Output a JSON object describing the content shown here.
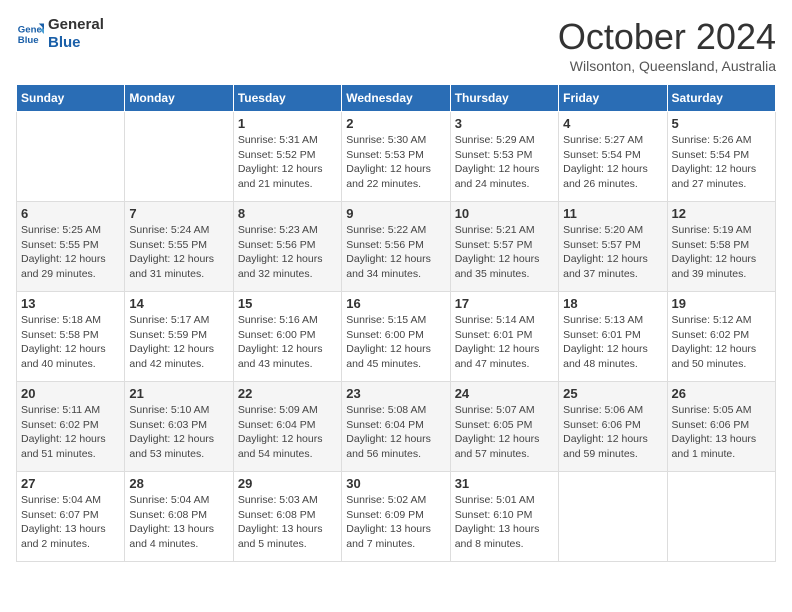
{
  "logo": {
    "line1": "General",
    "line2": "Blue"
  },
  "title": "October 2024",
  "subtitle": "Wilsonton, Queensland, Australia",
  "weekdays": [
    "Sunday",
    "Monday",
    "Tuesday",
    "Wednesday",
    "Thursday",
    "Friday",
    "Saturday"
  ],
  "weeks": [
    [
      {
        "day": "",
        "info": ""
      },
      {
        "day": "",
        "info": ""
      },
      {
        "day": "1",
        "info": "Sunrise: 5:31 AM\nSunset: 5:52 PM\nDaylight: 12 hours and 21 minutes."
      },
      {
        "day": "2",
        "info": "Sunrise: 5:30 AM\nSunset: 5:53 PM\nDaylight: 12 hours and 22 minutes."
      },
      {
        "day": "3",
        "info": "Sunrise: 5:29 AM\nSunset: 5:53 PM\nDaylight: 12 hours and 24 minutes."
      },
      {
        "day": "4",
        "info": "Sunrise: 5:27 AM\nSunset: 5:54 PM\nDaylight: 12 hours and 26 minutes."
      },
      {
        "day": "5",
        "info": "Sunrise: 5:26 AM\nSunset: 5:54 PM\nDaylight: 12 hours and 27 minutes."
      }
    ],
    [
      {
        "day": "6",
        "info": "Sunrise: 5:25 AM\nSunset: 5:55 PM\nDaylight: 12 hours and 29 minutes."
      },
      {
        "day": "7",
        "info": "Sunrise: 5:24 AM\nSunset: 5:55 PM\nDaylight: 12 hours and 31 minutes."
      },
      {
        "day": "8",
        "info": "Sunrise: 5:23 AM\nSunset: 5:56 PM\nDaylight: 12 hours and 32 minutes."
      },
      {
        "day": "9",
        "info": "Sunrise: 5:22 AM\nSunset: 5:56 PM\nDaylight: 12 hours and 34 minutes."
      },
      {
        "day": "10",
        "info": "Sunrise: 5:21 AM\nSunset: 5:57 PM\nDaylight: 12 hours and 35 minutes."
      },
      {
        "day": "11",
        "info": "Sunrise: 5:20 AM\nSunset: 5:57 PM\nDaylight: 12 hours and 37 minutes."
      },
      {
        "day": "12",
        "info": "Sunrise: 5:19 AM\nSunset: 5:58 PM\nDaylight: 12 hours and 39 minutes."
      }
    ],
    [
      {
        "day": "13",
        "info": "Sunrise: 5:18 AM\nSunset: 5:58 PM\nDaylight: 12 hours and 40 minutes."
      },
      {
        "day": "14",
        "info": "Sunrise: 5:17 AM\nSunset: 5:59 PM\nDaylight: 12 hours and 42 minutes."
      },
      {
        "day": "15",
        "info": "Sunrise: 5:16 AM\nSunset: 6:00 PM\nDaylight: 12 hours and 43 minutes."
      },
      {
        "day": "16",
        "info": "Sunrise: 5:15 AM\nSunset: 6:00 PM\nDaylight: 12 hours and 45 minutes."
      },
      {
        "day": "17",
        "info": "Sunrise: 5:14 AM\nSunset: 6:01 PM\nDaylight: 12 hours and 47 minutes."
      },
      {
        "day": "18",
        "info": "Sunrise: 5:13 AM\nSunset: 6:01 PM\nDaylight: 12 hours and 48 minutes."
      },
      {
        "day": "19",
        "info": "Sunrise: 5:12 AM\nSunset: 6:02 PM\nDaylight: 12 hours and 50 minutes."
      }
    ],
    [
      {
        "day": "20",
        "info": "Sunrise: 5:11 AM\nSunset: 6:02 PM\nDaylight: 12 hours and 51 minutes."
      },
      {
        "day": "21",
        "info": "Sunrise: 5:10 AM\nSunset: 6:03 PM\nDaylight: 12 hours and 53 minutes."
      },
      {
        "day": "22",
        "info": "Sunrise: 5:09 AM\nSunset: 6:04 PM\nDaylight: 12 hours and 54 minutes."
      },
      {
        "day": "23",
        "info": "Sunrise: 5:08 AM\nSunset: 6:04 PM\nDaylight: 12 hours and 56 minutes."
      },
      {
        "day": "24",
        "info": "Sunrise: 5:07 AM\nSunset: 6:05 PM\nDaylight: 12 hours and 57 minutes."
      },
      {
        "day": "25",
        "info": "Sunrise: 5:06 AM\nSunset: 6:06 PM\nDaylight: 12 hours and 59 minutes."
      },
      {
        "day": "26",
        "info": "Sunrise: 5:05 AM\nSunset: 6:06 PM\nDaylight: 13 hours and 1 minute."
      }
    ],
    [
      {
        "day": "27",
        "info": "Sunrise: 5:04 AM\nSunset: 6:07 PM\nDaylight: 13 hours and 2 minutes."
      },
      {
        "day": "28",
        "info": "Sunrise: 5:04 AM\nSunset: 6:08 PM\nDaylight: 13 hours and 4 minutes."
      },
      {
        "day": "29",
        "info": "Sunrise: 5:03 AM\nSunset: 6:08 PM\nDaylight: 13 hours and 5 minutes."
      },
      {
        "day": "30",
        "info": "Sunrise: 5:02 AM\nSunset: 6:09 PM\nDaylight: 13 hours and 7 minutes."
      },
      {
        "day": "31",
        "info": "Sunrise: 5:01 AM\nSunset: 6:10 PM\nDaylight: 13 hours and 8 minutes."
      },
      {
        "day": "",
        "info": ""
      },
      {
        "day": "",
        "info": ""
      }
    ]
  ]
}
